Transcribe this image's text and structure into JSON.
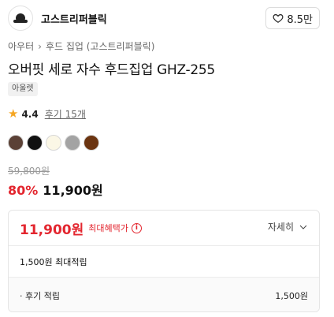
{
  "brand": {
    "name": "고스트리퍼블릭",
    "like_count": "8.5만"
  },
  "breadcrumb": {
    "category": "아우터",
    "subcategory": "후드 집업 (고스트리퍼블릭)"
  },
  "product": {
    "title": "오버핏 세로 자수 후드집업 GHZ-255",
    "tag": "아울렛",
    "rating": "4.4",
    "review_text": "후기 15개",
    "colors": [
      "#5b4136",
      "#111111",
      "#fbf7e6",
      "#a3a3a3",
      "#6b3410"
    ]
  },
  "price": {
    "original": "59,800원",
    "discount": "80%",
    "sale": "11,900원"
  },
  "benefit": {
    "price": "11,900원",
    "label": "최대혜택가",
    "detail_label": "자세히",
    "total_points": "1,500원 최대적립",
    "items": [
      {
        "label": "· 후기 적립",
        "value": "1,500원"
      }
    ]
  },
  "colors": {
    "accent_red": "#e3262f",
    "star": "#f5a623"
  }
}
